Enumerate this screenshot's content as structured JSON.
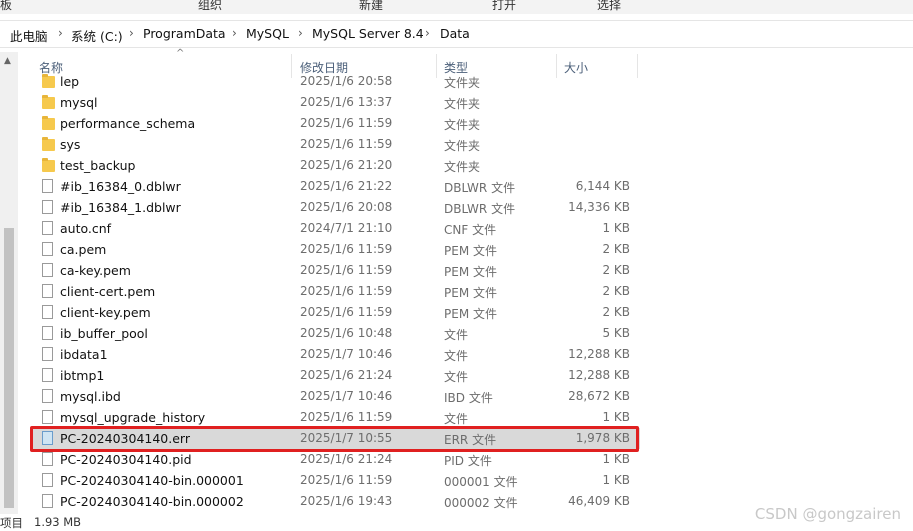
{
  "ribbon": {
    "left": "板",
    "organize": "组织",
    "new": "新建",
    "open": "打开",
    "select": "选择"
  },
  "breadcrumb": [
    "此电脑",
    "系统 (C:)",
    "ProgramData",
    "MySQL",
    "MySQL Server 8.4",
    "Data"
  ],
  "breadcrumb_separator": "›",
  "columns": {
    "name": "名称",
    "date": "修改日期",
    "type": "类型",
    "size": "大小"
  },
  "files": [
    {
      "name": "lep",
      "date": "2025/1/6 20:58",
      "type": "文件夹",
      "size": "",
      "icon": "folder-icon"
    },
    {
      "name": "mysql",
      "date": "2025/1/6 13:37",
      "type": "文件夹",
      "size": "",
      "icon": "folder-icon"
    },
    {
      "name": "performance_schema",
      "date": "2025/1/6 11:59",
      "type": "文件夹",
      "size": "",
      "icon": "folder-icon"
    },
    {
      "name": "sys",
      "date": "2025/1/6 11:59",
      "type": "文件夹",
      "size": "",
      "icon": "folder-icon"
    },
    {
      "name": "test_backup",
      "date": "2025/1/6 21:20",
      "type": "文件夹",
      "size": "",
      "icon": "folder-icon"
    },
    {
      "name": "#ib_16384_0.dblwr",
      "date": "2025/1/6 21:22",
      "type": "DBLWR 文件",
      "size": "6,144 KB",
      "icon": "file-icon"
    },
    {
      "name": "#ib_16384_1.dblwr",
      "date": "2025/1/6 20:08",
      "type": "DBLWR 文件",
      "size": "14,336 KB",
      "icon": "file-icon"
    },
    {
      "name": "auto.cnf",
      "date": "2024/7/1 21:10",
      "type": "CNF 文件",
      "size": "1 KB",
      "icon": "file-icon"
    },
    {
      "name": "ca.pem",
      "date": "2025/1/6 11:59",
      "type": "PEM 文件",
      "size": "2 KB",
      "icon": "file-icon"
    },
    {
      "name": "ca-key.pem",
      "date": "2025/1/6 11:59",
      "type": "PEM 文件",
      "size": "2 KB",
      "icon": "file-icon"
    },
    {
      "name": "client-cert.pem",
      "date": "2025/1/6 11:59",
      "type": "PEM 文件",
      "size": "2 KB",
      "icon": "file-icon"
    },
    {
      "name": "client-key.pem",
      "date": "2025/1/6 11:59",
      "type": "PEM 文件",
      "size": "2 KB",
      "icon": "file-icon"
    },
    {
      "name": "ib_buffer_pool",
      "date": "2025/1/6 10:48",
      "type": "文件",
      "size": "5 KB",
      "icon": "file-icon"
    },
    {
      "name": "ibdata1",
      "date": "2025/1/7 10:46",
      "type": "文件",
      "size": "12,288 KB",
      "icon": "file-icon"
    },
    {
      "name": "ibtmp1",
      "date": "2025/1/6 21:24",
      "type": "文件",
      "size": "12,288 KB",
      "icon": "file-icon"
    },
    {
      "name": "mysql.ibd",
      "date": "2025/1/7 10:46",
      "type": "IBD 文件",
      "size": "28,672 KB",
      "icon": "file-icon"
    },
    {
      "name": "mysql_upgrade_history",
      "date": "2025/1/6 11:59",
      "type": "文件",
      "size": "1 KB",
      "icon": "file-icon"
    },
    {
      "name": "PC-20240304140.err",
      "date": "2025/1/7 10:55",
      "type": "ERR 文件",
      "size": "1,978 KB",
      "icon": "log-file-icon",
      "selected": true
    },
    {
      "name": "PC-20240304140.pid",
      "date": "2025/1/6 21:24",
      "type": "PID 文件",
      "size": "1 KB",
      "icon": "file-icon"
    },
    {
      "name": "PC-20240304140-bin.000001",
      "date": "2025/1/6 11:59",
      "type": "000001 文件",
      "size": "1 KB",
      "icon": "file-icon"
    },
    {
      "name": "PC-20240304140-bin.000002",
      "date": "2025/1/6 19:43",
      "type": "000002 文件",
      "size": "46,409 KB",
      "icon": "file-icon"
    }
  ],
  "highlight_color": "#e02020",
  "status": {
    "items": "项目",
    "selected_size": "1.93 MB"
  },
  "watermark": "CSDN @gongzairen"
}
